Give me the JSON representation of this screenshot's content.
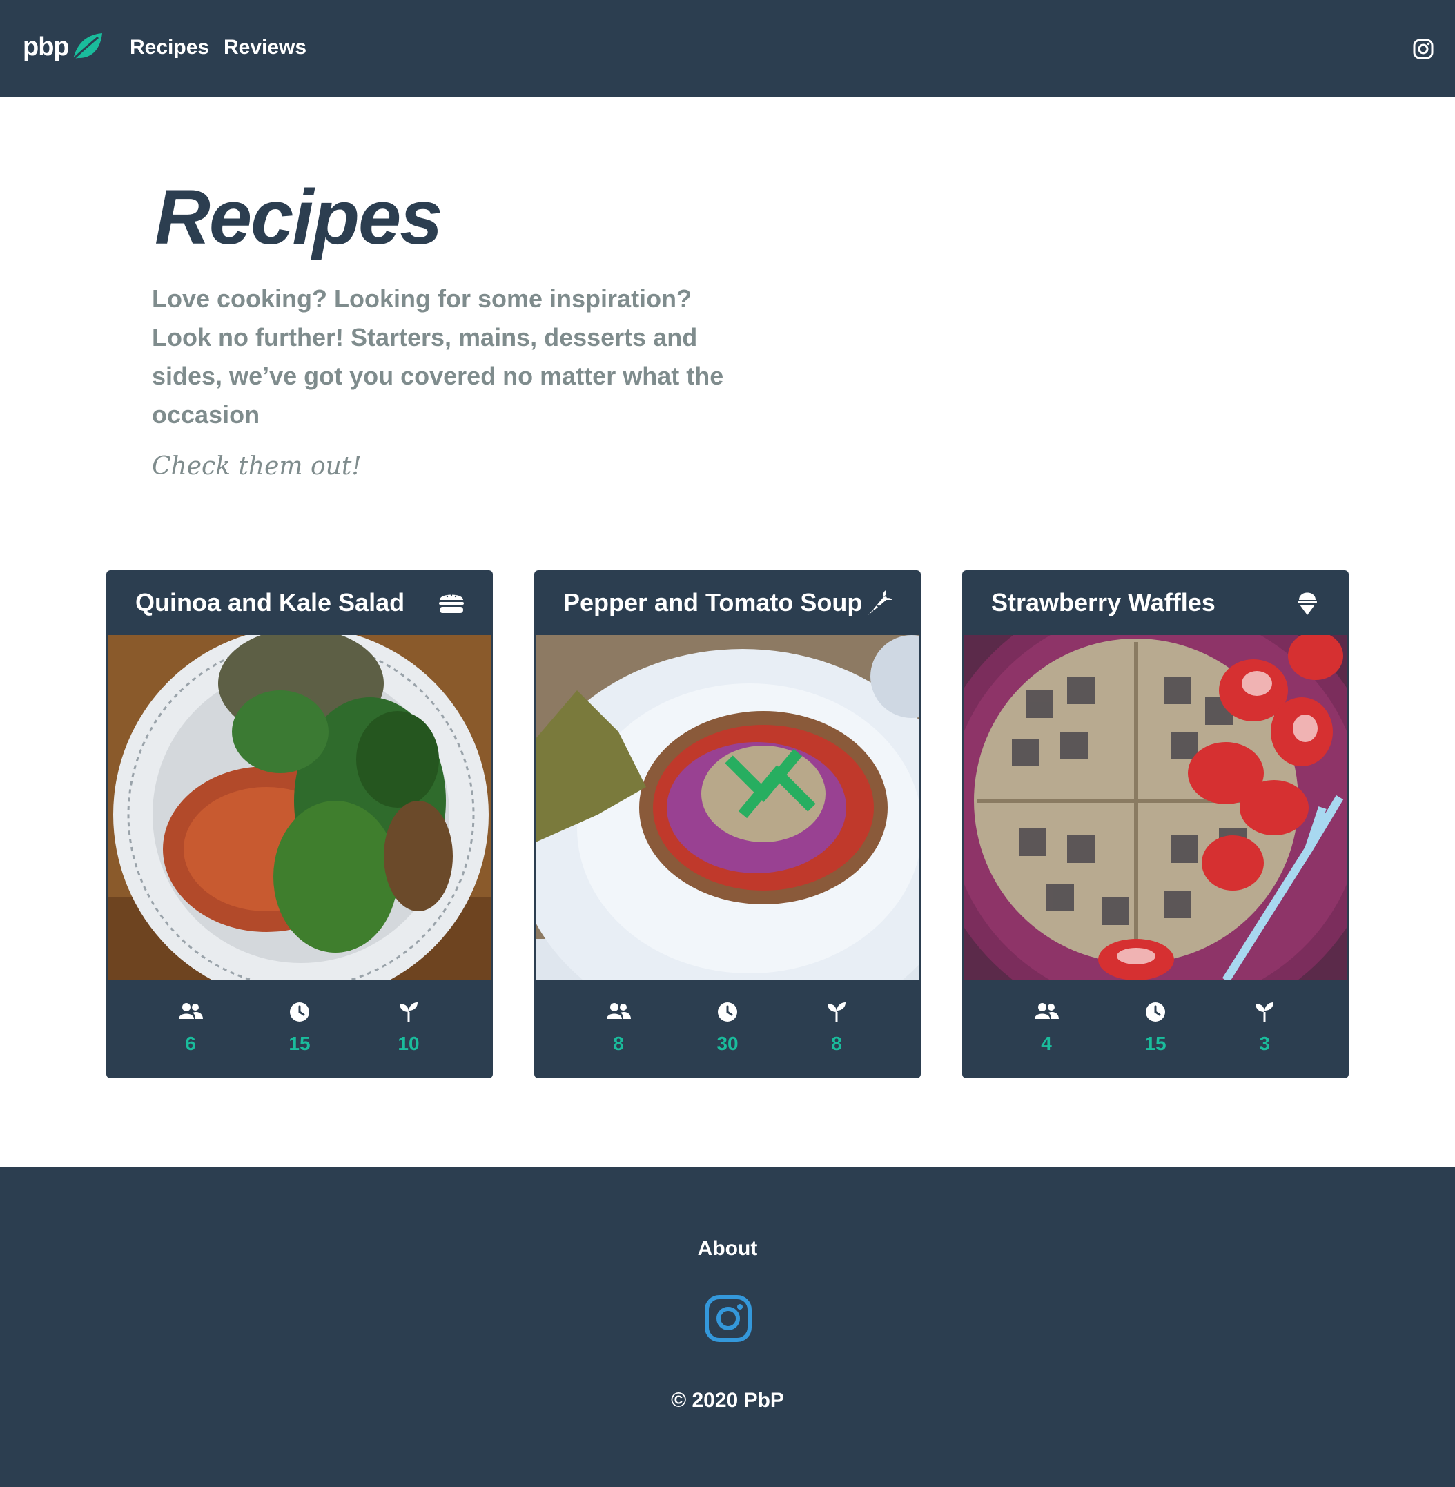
{
  "navbar": {
    "logo_text": "pbp",
    "links": [
      "Recipes",
      "Reviews"
    ],
    "social_icon": "instagram-icon"
  },
  "hero": {
    "title": "Recipes",
    "description": "Love cooking? Looking for some inspiration? Look no further! Starters, mains, desserts and sides, we’ve got you covered no matter what the occasion",
    "cta": "Check them out!"
  },
  "cards": [
    {
      "title": "Quinoa and Kale Salad",
      "type_icon": "burger-icon",
      "image_desc": "salad-plate",
      "servings": "6",
      "time": "15",
      "ingredients": "10"
    },
    {
      "title": "Pepper and Tomato Soup",
      "type_icon": "carrot-icon",
      "image_desc": "soup-plate",
      "servings": "8",
      "time": "30",
      "ingredients": "8"
    },
    {
      "title": "Strawberry Waffles",
      "type_icon": "ice-cream-icon",
      "image_desc": "waffle-plate",
      "servings": "4",
      "time": "15",
      "ingredients": "3"
    }
  ],
  "stat_icons": [
    "users-icon",
    "clock-icon",
    "seedling-icon"
  ],
  "footer": {
    "about": "About",
    "copyright": "© 2020 PbP"
  },
  "colors": {
    "primary": "#2c3e50",
    "accent": "#1abc9c",
    "muted_text": "#7f8c8d",
    "instagram_blue": "#3498db"
  }
}
